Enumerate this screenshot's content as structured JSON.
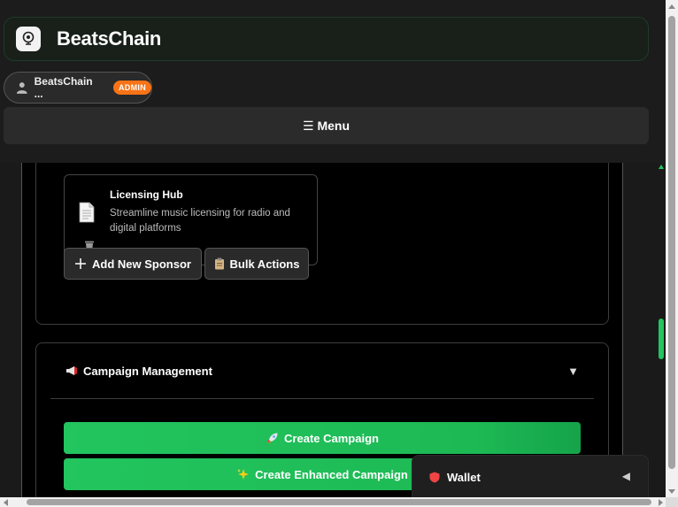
{
  "app": {
    "title": "BeatsChain",
    "logo_icon": "beatschain-logo-icon"
  },
  "user": {
    "name": "BeatsChain ...",
    "role_badge": "ADMIN",
    "badge_color": "#f97316"
  },
  "nav": {
    "menu_label": "☰ Menu"
  },
  "sponsors": {
    "card": {
      "title": "Licensing Hub",
      "description": "Streamline music licensing for radio and digital platforms",
      "icon": "document-icon",
      "delete_icon": "trash-icon"
    },
    "add_button": "Add New Sponsor",
    "bulk_button": "Bulk Actions"
  },
  "campaigns": {
    "title": "Campaign Management",
    "toggle": "▼",
    "create_button": "Create Campaign",
    "create_enhanced_button": "Create Enhanced Campaign"
  },
  "wallet": {
    "label": "Wallet",
    "toggle": "◀"
  },
  "colors": {
    "accent_green": "#22c55e",
    "background": "#1a1a1a",
    "panel": "#000000"
  }
}
